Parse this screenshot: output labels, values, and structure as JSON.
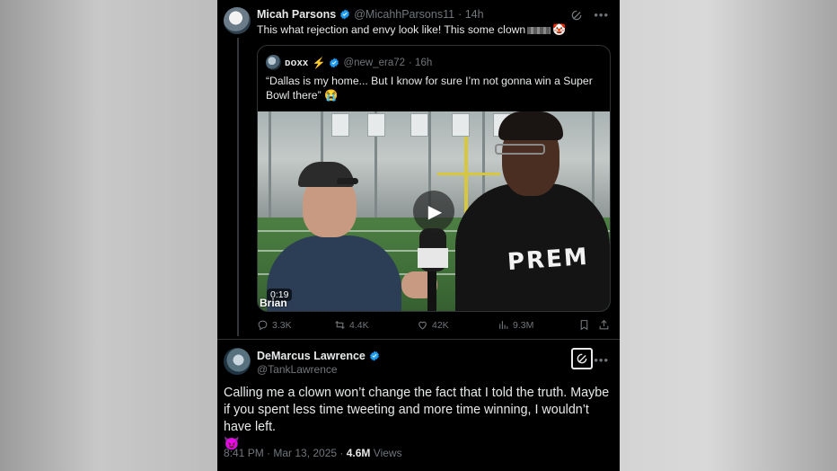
{
  "tweet1": {
    "name": "Micah Parsons",
    "handle": "@MicahhParsons11",
    "time": "· 14h",
    "text_before": "This what rejection and envy look like! This some clown",
    "text_emoji": "🤡"
  },
  "quote": {
    "name": "ᴅᴏxx",
    "name_emoji": "⚡",
    "handle": "@new_era72",
    "time": "· 16h",
    "text": "“Dallas is my home... But I know for sure I’m not gonna win a Super Bowl there” 😭",
    "video": {
      "duration": "0:19",
      "caption": "Brian",
      "hoodie_text": "PREM"
    }
  },
  "actions": {
    "replies": "3.3K",
    "reposts": "4.4K",
    "likes": "42K",
    "views": "9.3M"
  },
  "tweet2": {
    "name": "DeMarcus Lawrence",
    "handle": "@TankLawrence",
    "text": "Calling me a clown won’t change the fact that I told the truth. Maybe if you spent less time tweeting and more time winning, I wouldn’t have left.",
    "text_emoji": "😈",
    "time": "8:41 PM · Mar 13, 2025 ·",
    "views_count": "4.6M",
    "views_label": "Views"
  },
  "icons": [
    "verified-icon",
    "grok-icon",
    "more-icon",
    "play-icon",
    "reply-icon",
    "repost-icon",
    "like-icon",
    "views-icon",
    "bookmark-icon",
    "share-icon"
  ],
  "colors": {
    "background": "#000000",
    "text": "#e7e9ea",
    "muted": "#71767b",
    "verified": "#1d9bf0"
  }
}
